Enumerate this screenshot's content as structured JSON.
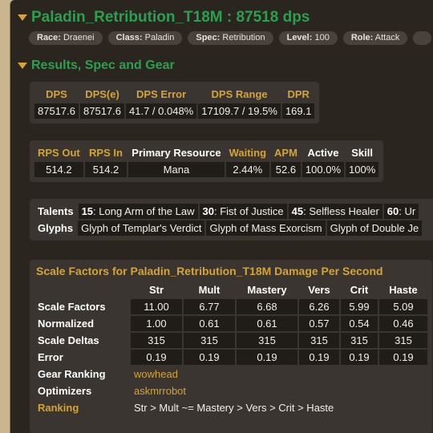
{
  "title": "Paladin_Retribution_T18M : 87518 dps",
  "pills": [
    {
      "label": "Race:",
      "value": "Draenei"
    },
    {
      "label": "Class:",
      "value": "Paladin"
    },
    {
      "label": "Spec:",
      "value": "Retribution"
    },
    {
      "label": "Level:",
      "value": "100"
    },
    {
      "label": "Role:",
      "value": "Attack"
    }
  ],
  "section_title": "Results, Spec and Gear",
  "dps_table": {
    "headers": [
      "DPS",
      "DPS(e)",
      "DPS Error",
      "DPS Range",
      "DPR"
    ],
    "values": [
      "87517.6",
      "87517.6",
      "41.7 / 0.048%",
      "17109.7 / 19.5%",
      "169.1"
    ]
  },
  "rps_table": {
    "headers": [
      "RPS Out",
      "RPS In",
      "Primary Resource",
      "Waiting",
      "APM",
      "Active",
      "Skill"
    ],
    "values": [
      "514.2",
      "514.2",
      "Mana",
      "2.44%",
      "52.6",
      "100.0%",
      "100%"
    ]
  },
  "talents": {
    "label": "Talents",
    "items": [
      {
        "tier": "15",
        "name": ": Long Arm of the Law"
      },
      {
        "tier": "30",
        "name": ": Fist of Justice"
      },
      {
        "tier": "45",
        "name": ": Selfless Healer"
      },
      {
        "tier": "60",
        "name": ": Ur"
      }
    ]
  },
  "glyphs": {
    "label": "Glyphs",
    "items": [
      "Glyph of Templar's Verdict",
      "Glyph of Mass Exorcism",
      "Glyph of Double Je"
    ]
  },
  "scale_factors": {
    "title": "Scale Factors for Paladin_Retribution_T18M Damage Per Second",
    "columns": [
      "Str",
      "Mult",
      "Mastery",
      "Vers",
      "Crit",
      "Haste"
    ],
    "rows": [
      {
        "label": "Scale Factors",
        "values": [
          "11.00",
          "6.77",
          "6.68",
          "6.26",
          "5.99",
          "5.09"
        ]
      },
      {
        "label": "Normalized",
        "values": [
          "1.00",
          "0.61",
          "0.61",
          "0.57",
          "0.54",
          "0.46"
        ]
      },
      {
        "label": "Scale Deltas",
        "values": [
          "315",
          "315",
          "315",
          "315",
          "315",
          "315"
        ]
      },
      {
        "label": "Error",
        "values": [
          "0.19",
          "0.19",
          "0.19",
          "0.19",
          "0.19",
          "0.19"
        ]
      }
    ],
    "gear_ranking_label": "Gear Ranking",
    "gear_ranking_link": "wowhead",
    "optimizers_label": "Optimizers",
    "optimizers_link": "askmrrobot",
    "cut_label": "Ranking",
    "cut_value": "Str > Mult ~= Mastery > Vers > Crit > Haste"
  }
}
